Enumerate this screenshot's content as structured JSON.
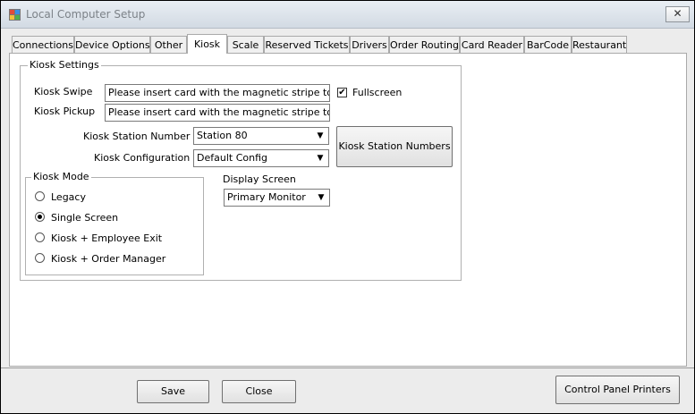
{
  "window": {
    "title": "Local Computer Setup",
    "close_glyph": "✕"
  },
  "tabs": [
    {
      "label": "Connections"
    },
    {
      "label": "Device Options"
    },
    {
      "label": "Other"
    },
    {
      "label": "Kiosk",
      "active": true
    },
    {
      "label": "Scale"
    },
    {
      "label": "Reserved Tickets"
    },
    {
      "label": "Drivers"
    },
    {
      "label": "Order Routing"
    },
    {
      "label": "Card Reader"
    },
    {
      "label": "BarCode"
    },
    {
      "label": "Restaurant"
    }
  ],
  "kiosk_settings": {
    "group_label": "Kiosk Settings",
    "swipe_label": "Kiosk Swipe",
    "swipe_value": "Please insert card with the magnetic stripe to the left",
    "pickup_label": "Kiosk Pickup",
    "pickup_value": "Please insert card with the magnetic stripe to the left",
    "fullscreen_label": "Fullscreen",
    "fullscreen_checked": true,
    "station_number_label": "Kiosk Station Number",
    "station_number_value": "Station 80",
    "configuration_label": "Kiosk Configuration",
    "configuration_value": "Default Config",
    "station_numbers_button": "Kiosk Station Numbers",
    "display_screen_label": "Display Screen",
    "display_screen_value": "Primary Monitor"
  },
  "kiosk_mode": {
    "group_label": "Kiosk Mode",
    "options": [
      {
        "label": "Legacy",
        "selected": false
      },
      {
        "label": "Single Screen",
        "selected": true
      },
      {
        "label": "Kiosk + Employee Exit",
        "selected": false
      },
      {
        "label": "Kiosk + Order Manager",
        "selected": false
      }
    ]
  },
  "footer": {
    "save": "Save",
    "close": "Close",
    "control_panel_printers": "Control Panel Printers"
  },
  "icons": {
    "dropdown": "▼",
    "check": "✔"
  }
}
